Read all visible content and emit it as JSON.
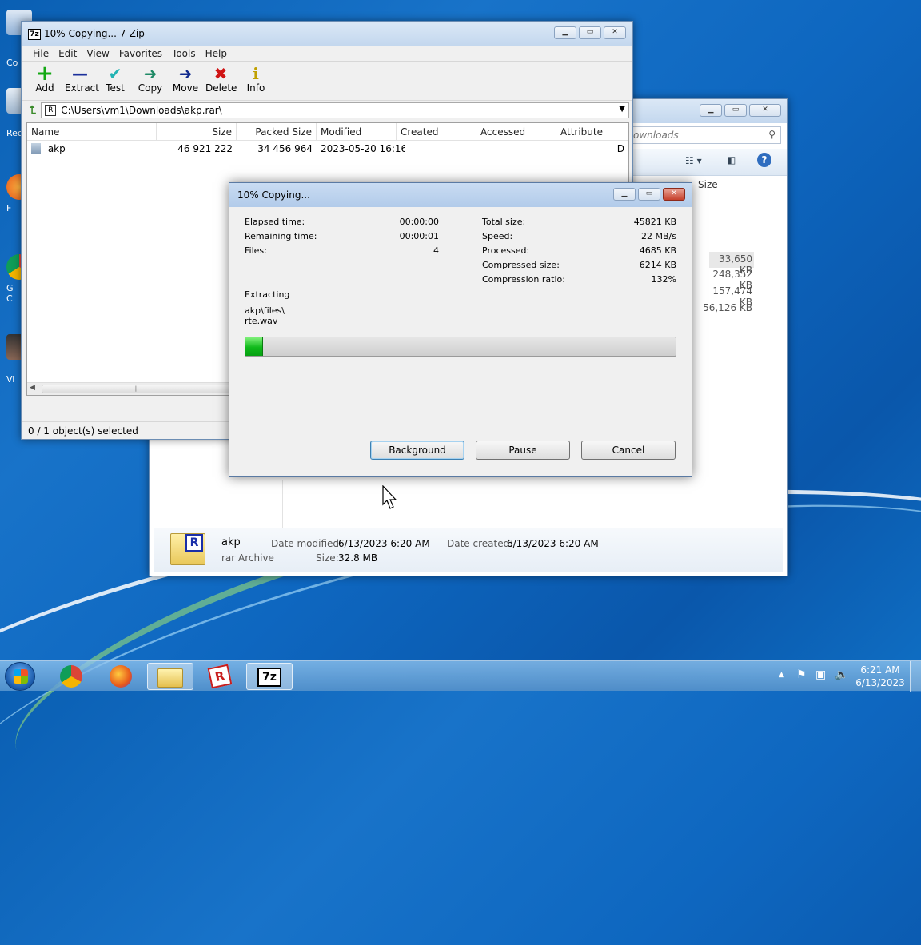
{
  "sevenzip": {
    "title": "10% Copying... 7-Zip",
    "app_icon": "7z",
    "menu": [
      "File",
      "Edit",
      "View",
      "Favorites",
      "Tools",
      "Help"
    ],
    "toolbar": [
      {
        "label": "Add",
        "icon": "+",
        "color": "#14a814"
      },
      {
        "label": "Extract",
        "icon": "—",
        "color": "#1b2f9b"
      },
      {
        "label": "Test",
        "icon": "✔",
        "color": "#22b3b3"
      },
      {
        "label": "Copy",
        "icon": "➜",
        "color": "#1f8a66"
      },
      {
        "label": "Move",
        "icon": "➜",
        "color": "#102a8e"
      },
      {
        "label": "Delete",
        "icon": "✖",
        "color": "#d01414"
      },
      {
        "label": "Info",
        "icon": "i",
        "color": "#c0a000"
      }
    ],
    "address": "C:\\Users\\vm1\\Downloads\\akp.rar\\",
    "columns": [
      "Name",
      "Size",
      "Packed Size",
      "Modified",
      "Created",
      "Accessed",
      "Attribute"
    ],
    "rows": [
      {
        "name": "akp",
        "size": "46 921 222",
        "packed": "34 456 964",
        "modified": "2023-05-20 16:16",
        "created": "",
        "accessed": "",
        "attr": "D"
      }
    ],
    "status": "0 / 1 object(s) selected"
  },
  "explorer": {
    "search_placeholder": "ownloads",
    "size_header": "Size",
    "sizes": [
      "33,650 KB",
      "248,352 KB",
      "157,474 KB",
      "56,126 KB"
    ],
    "details": {
      "name": "akp",
      "type": "rar Archive",
      "modified_label": "Date modified:",
      "modified_value": "6/13/2023 6:20 AM",
      "created_label": "Date created:",
      "created_value": "6/13/2023 6:20 AM",
      "size_label": "Size:",
      "size_value": "32.8 MB"
    }
  },
  "progress": {
    "title": "10% Copying...",
    "left_stats": [
      {
        "label": "Elapsed time:",
        "value": "00:00:00"
      },
      {
        "label": "Remaining time:",
        "value": "00:00:01"
      },
      {
        "label": "Files:",
        "value": "4"
      }
    ],
    "right_stats": [
      {
        "label": "Total size:",
        "value": "45821 KB"
      },
      {
        "label": "Speed:",
        "value": "22 MB/s"
      },
      {
        "label": "Processed:",
        "value": "4685 KB"
      },
      {
        "label": "Compressed size:",
        "value": "6214 KB"
      },
      {
        "label": "Compression ratio:",
        "value": "132%"
      }
    ],
    "action": "Extracting",
    "path_line1": "akp\\files\\",
    "path_line2": "rte.wav",
    "percent": 4,
    "buttons": {
      "background": "Background",
      "pause": "Pause",
      "cancel": "Cancel"
    }
  },
  "taskbar": {
    "time": "6:21 AM",
    "date": "6/13/2023",
    "sevenzip_label": "7z"
  },
  "desktop": {
    "icons": [
      "Co",
      "Rec",
      "F",
      "G\nC",
      "Vi"
    ]
  }
}
